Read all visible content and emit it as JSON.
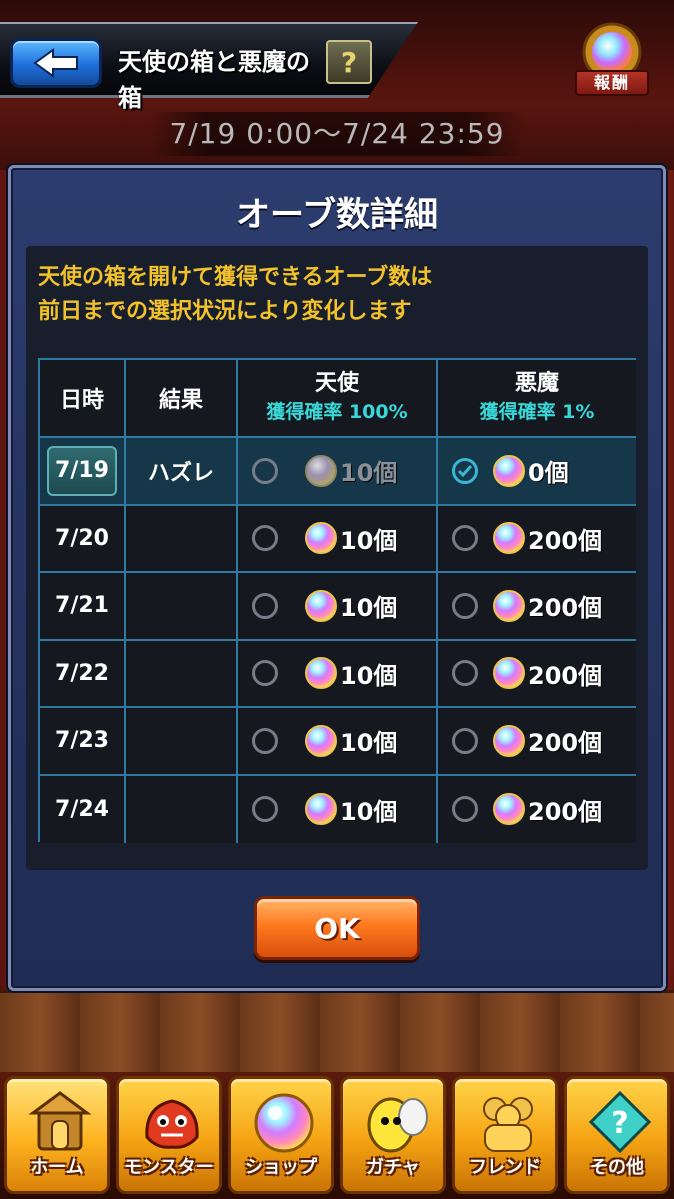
{
  "header": {
    "title": "天使の箱と悪魔の箱",
    "help_label": "?",
    "reward_label": "報酬"
  },
  "period": "7/19 0:00〜7/24 23:59",
  "dialog": {
    "title": "オーブ数詳細",
    "notice": [
      "天使の箱を開けて獲得できるオーブ数は",
      "前日までの選択状況により変化します"
    ],
    "table": {
      "headers": {
        "date": "日時",
        "result": "結果",
        "angel": "天使",
        "angel_rate": "獲得確率 100%",
        "devil": "悪魔",
        "devil_rate": "獲得確率 1%"
      },
      "rows": [
        {
          "date": "7/19",
          "result": "ハズレ",
          "angel": "10個",
          "devil": "0個",
          "angel_checked": false,
          "devil_checked": true,
          "selected": true
        },
        {
          "date": "7/20",
          "result": "",
          "angel": "10個",
          "devil": "200個",
          "angel_checked": false,
          "devil_checked": false,
          "selected": false
        },
        {
          "date": "7/21",
          "result": "",
          "angel": "10個",
          "devil": "200個",
          "angel_checked": false,
          "devil_checked": false,
          "selected": false
        },
        {
          "date": "7/22",
          "result": "",
          "angel": "10個",
          "devil": "200個",
          "angel_checked": false,
          "devil_checked": false,
          "selected": false
        },
        {
          "date": "7/23",
          "result": "",
          "angel": "10個",
          "devil": "200個",
          "angel_checked": false,
          "devil_checked": false,
          "selected": false
        },
        {
          "date": "7/24",
          "result": "",
          "angel": "10個",
          "devil": "200個",
          "angel_checked": false,
          "devil_checked": false,
          "selected": false
        }
      ]
    },
    "ok_label": "OK"
  },
  "nav": {
    "items": [
      {
        "label": "ホーム",
        "icon": "home-icon"
      },
      {
        "label": "モンスター",
        "icon": "monster-icon"
      },
      {
        "label": "ショップ",
        "icon": "orb-shop-icon"
      },
      {
        "label": "ガチャ",
        "icon": "gacha-egg-icon"
      },
      {
        "label": "フレンド",
        "icon": "friends-icon"
      },
      {
        "label": "その他",
        "icon": "other-icon"
      }
    ]
  },
  "colors": {
    "accent_cyan": "#39d8d8",
    "notice_yellow": "#f2c22a",
    "table_border": "#2e7aa0",
    "ok_orange": "#ff7a1e"
  }
}
